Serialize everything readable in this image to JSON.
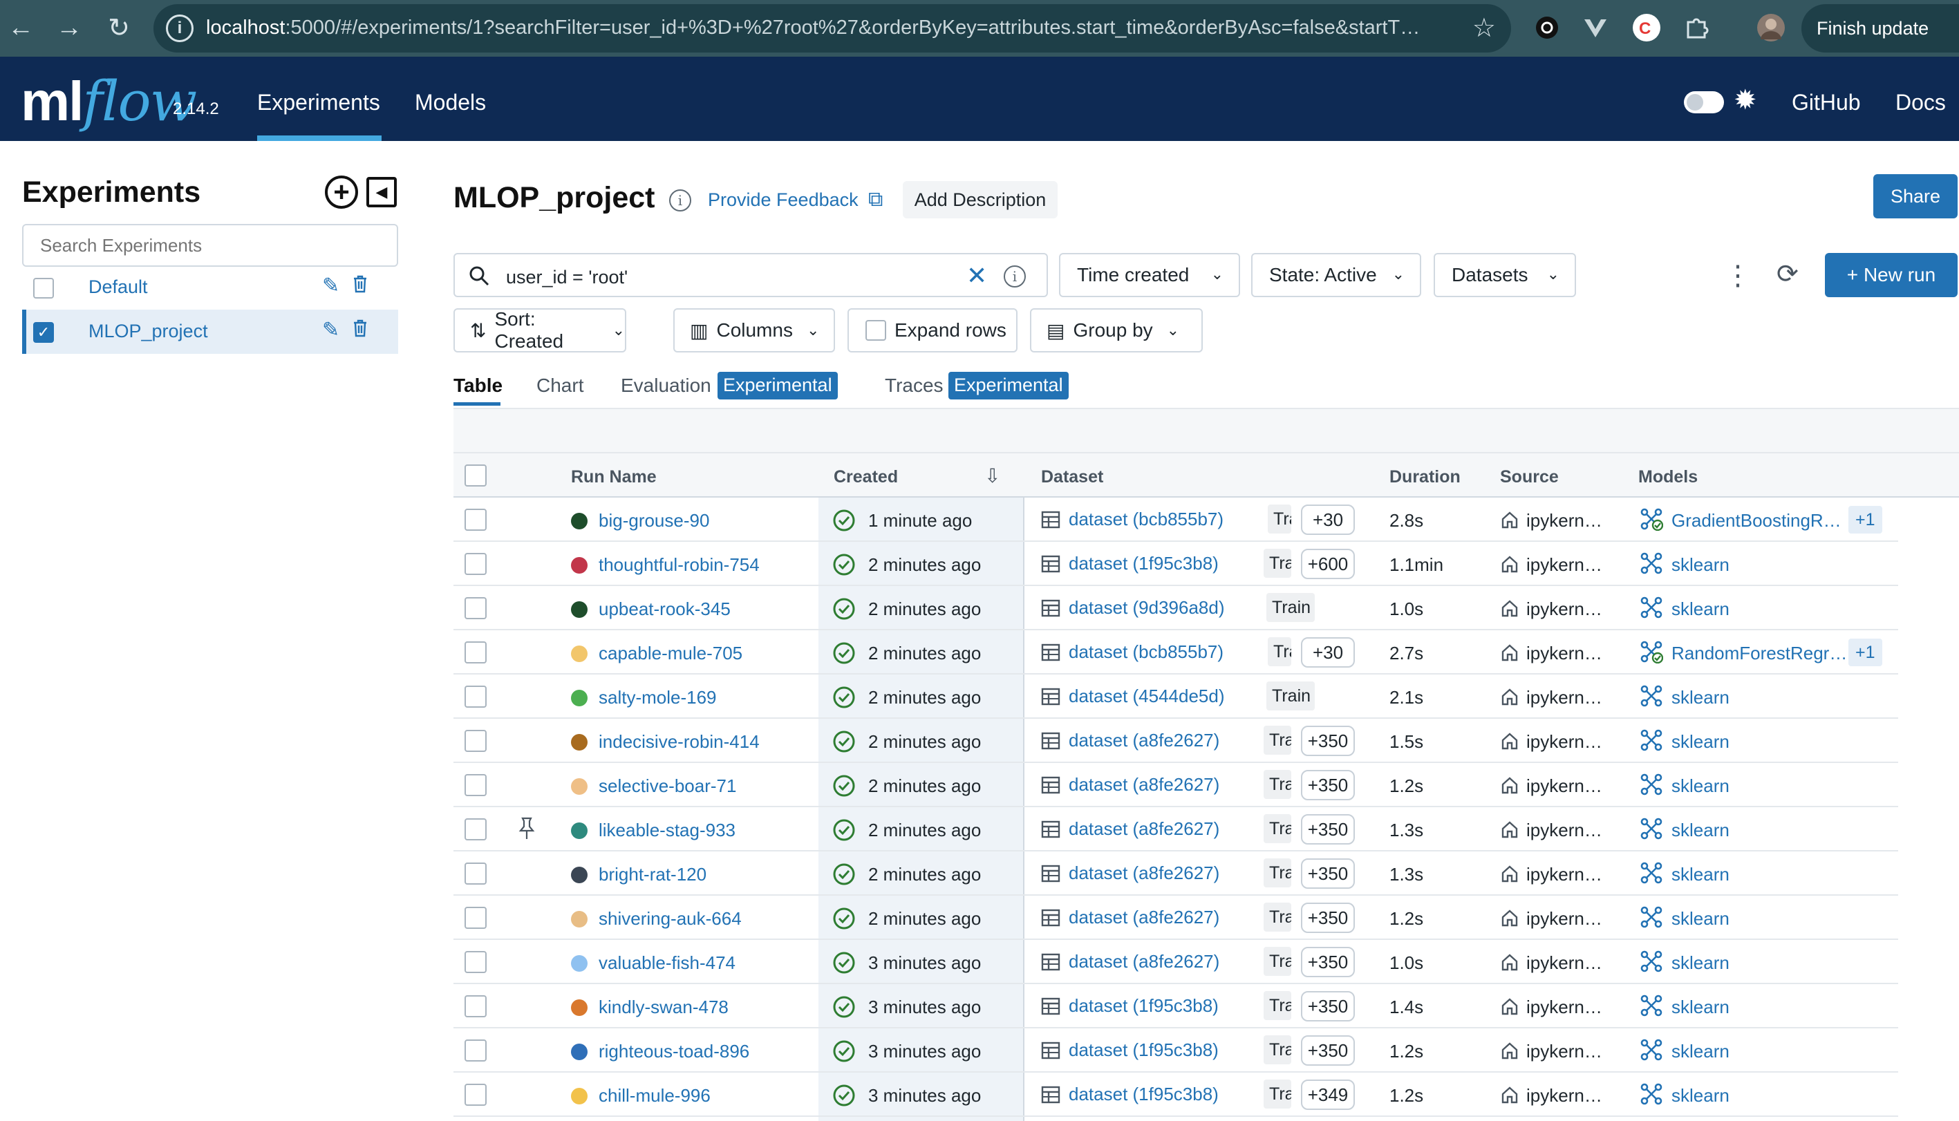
{
  "browser": {
    "url_host": "localhost",
    "url_rest": ":5000/#/experiments/1?searchFilter=user_id+%3D+%27root%27&orderByKey=attributes.start_time&orderByAsc=false&startT…",
    "finish_update": "Finish update"
  },
  "header": {
    "logo_ml": "ml",
    "logo_flow": "flow",
    "version": "2.14.2",
    "nav": [
      "Experiments",
      "Models"
    ],
    "github": "GitHub",
    "docs": "Docs"
  },
  "sidebar": {
    "title": "Experiments",
    "search_placeholder": "Search Experiments",
    "experiments": [
      {
        "name": "Default",
        "selected": false
      },
      {
        "name": "MLOP_project",
        "selected": true
      }
    ]
  },
  "main": {
    "title": "MLOP_project",
    "feedback": "Provide Feedback",
    "add_description": "Add Description",
    "share": "Share",
    "search_value": "user_id = 'root'",
    "filters": {
      "time": "Time created",
      "state": "State: Active",
      "datasets": "Datasets"
    },
    "new_run": "New run",
    "options": {
      "sort": "Sort: Created",
      "columns": "Columns",
      "expand": "Expand rows",
      "group": "Group by"
    },
    "tabs": {
      "table": "Table",
      "chart": "Chart",
      "evaluation": "Evaluation",
      "traces": "Traces",
      "experimental": "Experimental"
    }
  },
  "table": {
    "columns": [
      "Run Name",
      "Created",
      "Dataset",
      "Duration",
      "Source",
      "Models"
    ],
    "rows": [
      {
        "name": "big-grouse-90",
        "color": "#1e4d2b",
        "created": "1 minute ago",
        "dataset": "dataset (bcb855b7)",
        "tag": "Trair…",
        "more": "+30",
        "duration": "2.8s",
        "source": "ipykern…",
        "model": "GradientBoostingR…",
        "plus": "+1",
        "pinned": false,
        "model_kind": "registered"
      },
      {
        "name": "thoughtful-robin-754",
        "color": "#c2364a",
        "created": "2 minutes ago",
        "dataset": "dataset (1f95c3b8)",
        "tag": "Train…",
        "more": "+600",
        "duration": "1.1min",
        "source": "ipykern…",
        "model": "sklearn",
        "plus": "",
        "pinned": false,
        "model_kind": "logged"
      },
      {
        "name": "upbeat-rook-345",
        "color": "#1e4d2b",
        "created": "2 minutes ago",
        "dataset": "dataset (9d396a8d)",
        "tag": "Train",
        "more": "",
        "duration": "1.0s",
        "source": "ipykern…",
        "model": "sklearn",
        "plus": "",
        "pinned": false,
        "model_kind": "logged"
      },
      {
        "name": "capable-mule-705",
        "color": "#f2c66b",
        "created": "2 minutes ago",
        "dataset": "dataset (bcb855b7)",
        "tag": "Trair…",
        "more": "+30",
        "duration": "2.7s",
        "source": "ipykern…",
        "model": "RandomForestRegr…",
        "plus": "+1",
        "pinned": false,
        "model_kind": "registered"
      },
      {
        "name": "salty-mole-169",
        "color": "#4caf50",
        "created": "2 minutes ago",
        "dataset": "dataset (4544de5d)",
        "tag": "Train",
        "more": "",
        "duration": "2.1s",
        "source": "ipykern…",
        "model": "sklearn",
        "plus": "",
        "pinned": false,
        "model_kind": "logged"
      },
      {
        "name": "indecisive-robin-414",
        "color": "#a86b1f",
        "created": "2 minutes ago",
        "dataset": "dataset (a8fe2627)",
        "tag": "Train…",
        "more": "+350",
        "duration": "1.5s",
        "source": "ipykern…",
        "model": "sklearn",
        "plus": "",
        "pinned": false,
        "model_kind": "logged"
      },
      {
        "name": "selective-boar-71",
        "color": "#efbf86",
        "created": "2 minutes ago",
        "dataset": "dataset (a8fe2627)",
        "tag": "Train…",
        "more": "+350",
        "duration": "1.2s",
        "source": "ipykern…",
        "model": "sklearn",
        "plus": "",
        "pinned": false,
        "model_kind": "logged"
      },
      {
        "name": "likeable-stag-933",
        "color": "#2e8a7e",
        "created": "2 minutes ago",
        "dataset": "dataset (a8fe2627)",
        "tag": "Train…",
        "more": "+350",
        "duration": "1.3s",
        "source": "ipykern…",
        "model": "sklearn",
        "plus": "",
        "pinned": true,
        "model_kind": "logged"
      },
      {
        "name": "bright-rat-120",
        "color": "#3b4654",
        "created": "2 minutes ago",
        "dataset": "dataset (a8fe2627)",
        "tag": "Train…",
        "more": "+350",
        "duration": "1.3s",
        "source": "ipykern…",
        "model": "sklearn",
        "plus": "",
        "pinned": false,
        "model_kind": "logged"
      },
      {
        "name": "shivering-auk-664",
        "color": "#e8bd85",
        "created": "2 minutes ago",
        "dataset": "dataset (a8fe2627)",
        "tag": "Train…",
        "more": "+350",
        "duration": "1.2s",
        "source": "ipykern…",
        "model": "sklearn",
        "plus": "",
        "pinned": false,
        "model_kind": "logged"
      },
      {
        "name": "valuable-fish-474",
        "color": "#8fc1f0",
        "created": "3 minutes ago",
        "dataset": "dataset (a8fe2627)",
        "tag": "Train…",
        "more": "+350",
        "duration": "1.0s",
        "source": "ipykern…",
        "model": "sklearn",
        "plus": "",
        "pinned": false,
        "model_kind": "logged"
      },
      {
        "name": "kindly-swan-478",
        "color": "#d9782d",
        "created": "3 minutes ago",
        "dataset": "dataset (1f95c3b8)",
        "tag": "Train…",
        "more": "+350",
        "duration": "1.4s",
        "source": "ipykern…",
        "model": "sklearn",
        "plus": "",
        "pinned": false,
        "model_kind": "logged"
      },
      {
        "name": "righteous-toad-896",
        "color": "#2f6fb8",
        "created": "3 minutes ago",
        "dataset": "dataset (1f95c3b8)",
        "tag": "Train…",
        "more": "+350",
        "duration": "1.2s",
        "source": "ipykern…",
        "model": "sklearn",
        "plus": "",
        "pinned": false,
        "model_kind": "logged"
      },
      {
        "name": "chill-mule-996",
        "color": "#f2c24b",
        "created": "3 minutes ago",
        "dataset": "dataset (1f95c3b8)",
        "tag": "Train…",
        "more": "+349",
        "duration": "1.2s",
        "source": "ipykern…",
        "model": "sklearn",
        "plus": "",
        "pinned": false,
        "model_kind": "logged"
      }
    ]
  },
  "colors": {
    "accent": "#2272b4",
    "header_bg": "#0e2a54",
    "chrome_bg": "#34565f",
    "success": "#2e7d32"
  }
}
